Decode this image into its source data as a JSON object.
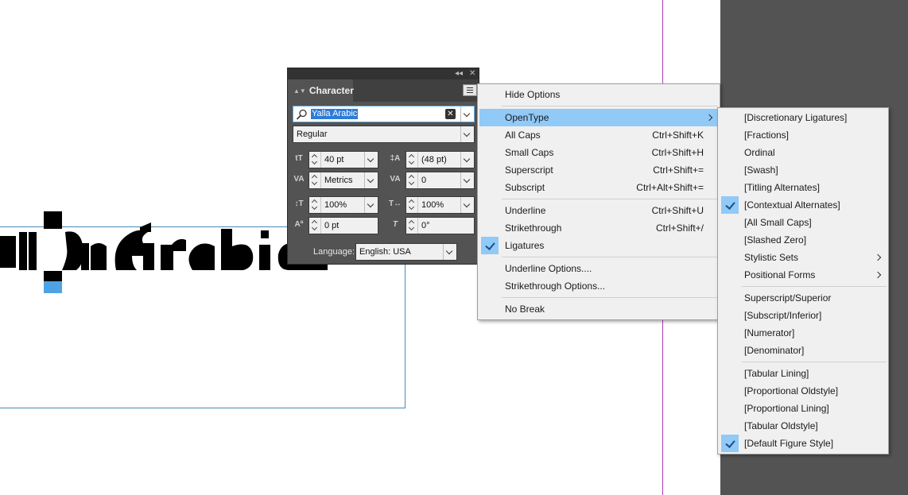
{
  "panel": {
    "title": "Character",
    "font_search": {
      "value": "Yalla Arabic"
    },
    "font_style": "Regular",
    "font_size": "40 pt",
    "leading": "(48 pt)",
    "kerning": "Metrics",
    "tracking": "0",
    "vertical_scale": "100%",
    "horizontal_scale": "100%",
    "baseline_shift": "0 pt",
    "skew": "0°",
    "language_label": "Language:",
    "language": "English: USA"
  },
  "main_menu": {
    "items": [
      {
        "label": "Hide Options"
      },
      {
        "label": "OpenType",
        "submenu": true,
        "highlighted": true
      },
      {
        "label": "All Caps",
        "shortcut": "Ctrl+Shift+K"
      },
      {
        "label": "Small Caps",
        "shortcut": "Ctrl+Shift+H"
      },
      {
        "label": "Superscript",
        "shortcut": "Ctrl+Shift+="
      },
      {
        "label": "Subscript",
        "shortcut": "Ctrl+Alt+Shift+="
      },
      {
        "label": "Underline",
        "shortcut": "Ctrl+Shift+U"
      },
      {
        "label": "Strikethrough",
        "shortcut": "Ctrl+Shift+/"
      },
      {
        "label": "Ligatures",
        "checked": true
      },
      {
        "label": "Underline Options...."
      },
      {
        "label": "Strikethrough Options..."
      },
      {
        "label": "No Break"
      }
    ]
  },
  "opentype_menu": {
    "items": [
      {
        "label": "[Discretionary Ligatures]"
      },
      {
        "label": "[Fractions]"
      },
      {
        "label": "Ordinal"
      },
      {
        "label": "[Swash]"
      },
      {
        "label": "[Titling Alternates]"
      },
      {
        "label": "[Contextual Alternates]",
        "checked": true
      },
      {
        "label": "[All Small Caps]"
      },
      {
        "label": "[Slashed Zero]"
      },
      {
        "label": "Stylistic Sets",
        "submenu": true
      },
      {
        "label": "Positional Forms",
        "submenu": true
      },
      {
        "label": "Superscript/Superior"
      },
      {
        "label": "[Subscript/Inferior]"
      },
      {
        "label": "[Numerator]"
      },
      {
        "label": "[Denominator]"
      },
      {
        "label": "[Tabular Lining]"
      },
      {
        "label": "[Proportional Oldstyle]"
      },
      {
        "label": "[Proportional Lining]"
      },
      {
        "label": "[Tabular Oldstyle]"
      },
      {
        "label": "[Default Figure Style]",
        "checked": true
      }
    ]
  },
  "colors": {
    "menu_highlight": "#91c9f7",
    "selection": "#2f7bd6",
    "margin_guide": "#b23bb6",
    "frame_edge": "#4a89b8",
    "pasteboard": "#535353"
  }
}
